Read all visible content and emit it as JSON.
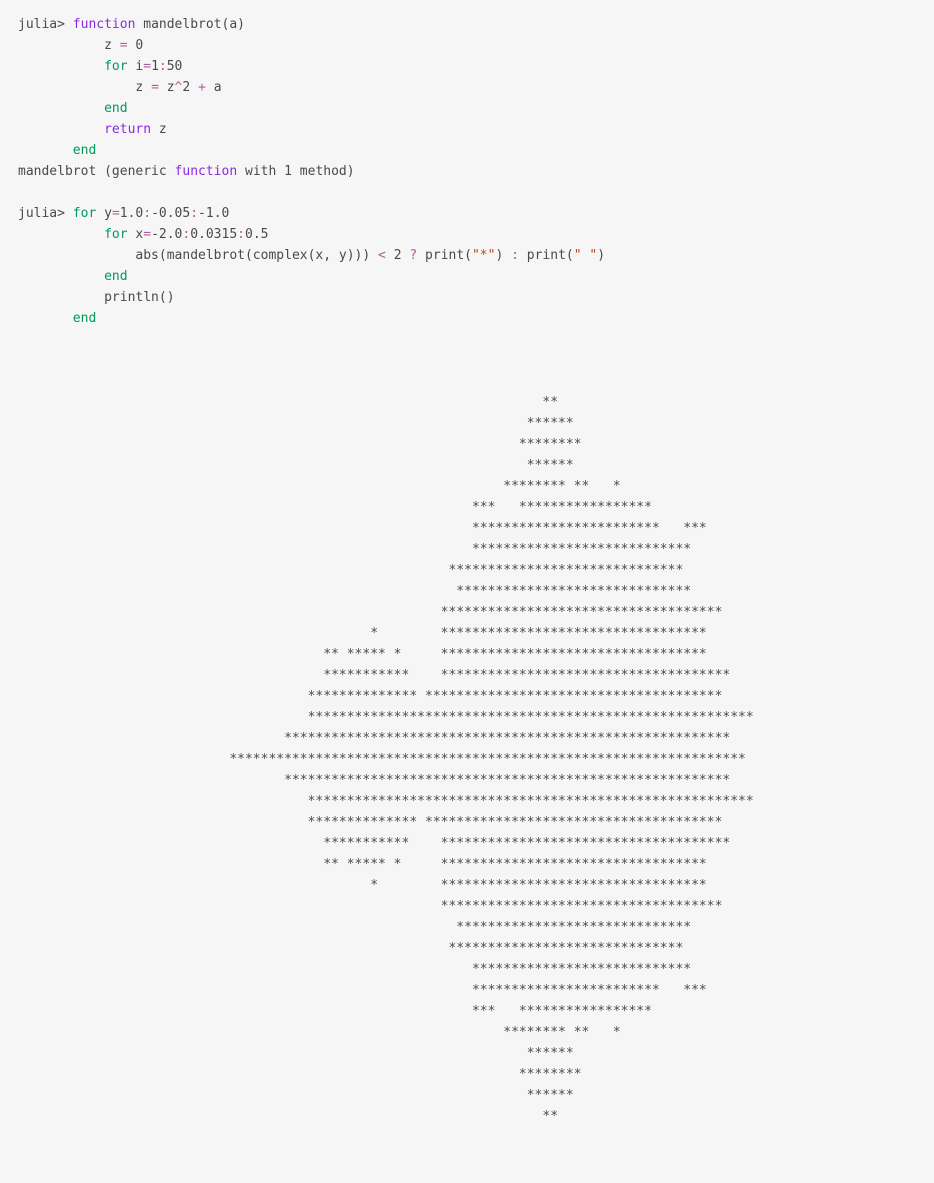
{
  "repl": {
    "prompt": "julia>",
    "block1": {
      "line1_kw_function": "function",
      "line1_rest": " mandelbrot(a)",
      "line2_var": "z ",
      "line2_eq": "=",
      "line2_val": " 0",
      "line3_for": "for",
      "line3_iter": " i",
      "line3_eq": "=",
      "line3_range_a": "1",
      "line3_colon": ":",
      "line3_range_b": "50",
      "line4_pre": "z ",
      "line4_eq": "=",
      "line4_mid": " z",
      "line4_caret": "^",
      "line4_two": "2",
      "line4_plus": " + ",
      "line4_a": "a",
      "line5_end": "end",
      "line6_return": "return",
      "line6_z": " z",
      "line7_end": "end",
      "result_pre": "mandelbrot (generic ",
      "result_fn": "function",
      "result_post": " with 1 method)"
    },
    "block2": {
      "line1_for": "for",
      "line1_y": " y",
      "line1_eq": "=",
      "line1_a": "1.0",
      "line1_c1": ":",
      "line1_b": "-0.05",
      "line1_c2": ":",
      "line1_c": "-1.0",
      "line2_for": "for",
      "line2_x": " x",
      "line2_eq": "=",
      "line2_a": "-2.0",
      "line2_c1": ":",
      "line2_b": "0.0315",
      "line2_c2": ":",
      "line2_c": "0.5",
      "line3_pre": "abs(mandelbrot(complex(x, y))) ",
      "line3_lt": "<",
      "line3_two": " 2 ",
      "line3_q": "?",
      "line3_p1": " print(",
      "line3_s1": "\"*\"",
      "line3_p1c": ") ",
      "line3_colon": ":",
      "line3_p2": " print(",
      "line3_s2": "\" \"",
      "line3_p2c": ")",
      "line4_end": "end",
      "line5_println": "println()",
      "line6_end": "end"
    }
  },
  "output_lines": [
    "                                                                                ",
    "                                                                                ",
    "                                                                                ",
    "                                                                   **           ",
    "                                                                 ******         ",
    "                                                                ********        ",
    "                                                                 ******         ",
    "                                                              ******** **   *   ",
    "                                                          ***   *****************",
    "                                                          ************************   ***",
    "                                                          ****************************",
    "                                                       ******************************",
    "                                                        ******************************",
    "                                                      ************************************",
    "                                             *        **********************************",
    "                                       ** ***** *     **********************************",
    "                                       ***********    *************************************",
    "                                     ************** **************************************",
    "                                     *********************************************************",
    "                                  *********************************************************",
    "                           ******************************************************************",
    "                                  *********************************************************",
    "                                     *********************************************************",
    "                                     ************** **************************************",
    "                                       ***********    *************************************",
    "                                       ** ***** *     **********************************",
    "                                             *        **********************************",
    "                                                      ************************************",
    "                                                        ******************************",
    "                                                       ******************************",
    "                                                          ****************************",
    "                                                          ************************   ***",
    "                                                          ***   *****************",
    "                                                              ******** **   *   ",
    "                                                                 ******         ",
    "                                                                ********        ",
    "                                                                 ******         ",
    "                                                                   **           ",
    "                                                                                ",
    "                                                                                "
  ]
}
